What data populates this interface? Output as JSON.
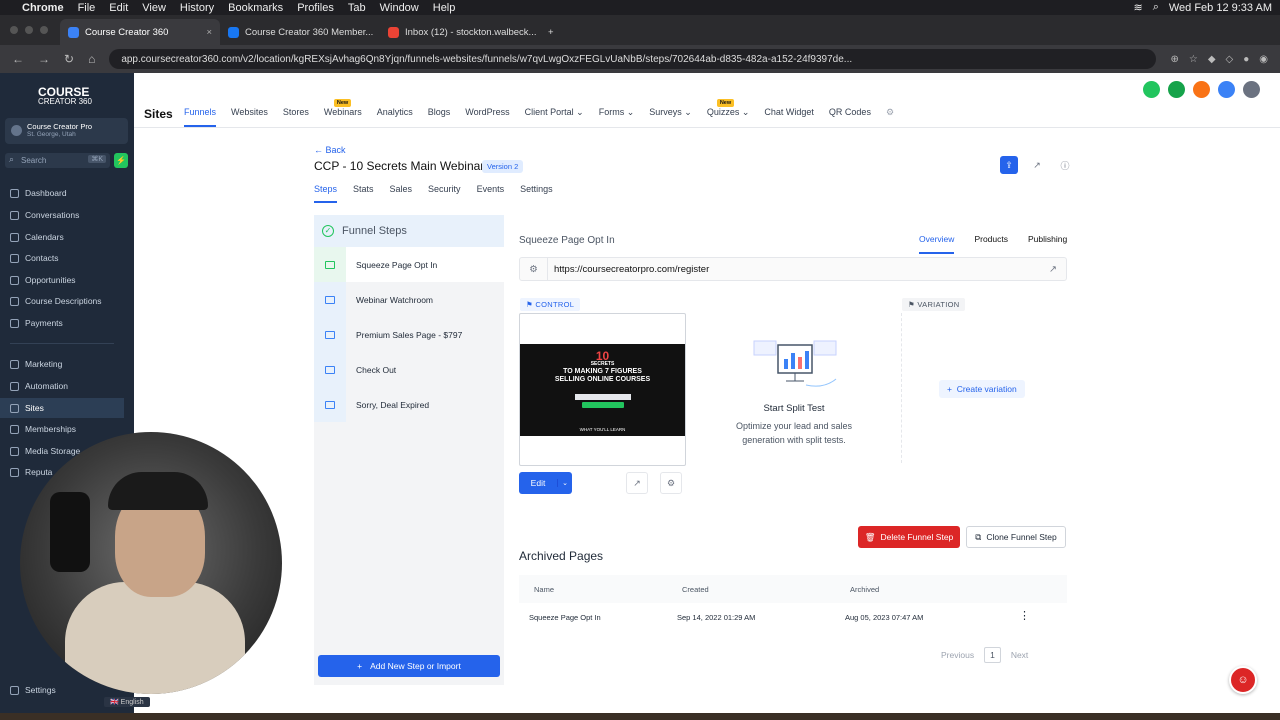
{
  "mac_menu": {
    "app": "Chrome",
    "items": [
      "File",
      "Edit",
      "View",
      "History",
      "Bookmarks",
      "Profiles",
      "Tab",
      "Window",
      "Help"
    ],
    "datetime": "Wed Feb 12  9:33 AM"
  },
  "browser": {
    "tabs": [
      {
        "title": "Course Creator 360",
        "color": "#3b82f6"
      },
      {
        "title": "Course Creator 360 Member...",
        "color": "#1877f2"
      },
      {
        "title": "Inbox (12) - stockton.walbeck...",
        "color": "#ea4335"
      }
    ],
    "url": "app.coursecreator360.com/v2/location/kgREXsjAvhag6Qn8Yjqn/funnels-websites/funnels/w7qvLwgOxzFEGLvUaNbB/steps/702644ab-d835-482a-a152-24f9397de..."
  },
  "sidebar": {
    "logo": "COURSE",
    "logo_sub": "CREATOR 360",
    "account_name": "Course Creator Pro",
    "account_location": "St. George, Utah",
    "search_placeholder": "Search",
    "search_shortcut": "⌘K",
    "items_top": [
      {
        "label": "Dashboard",
        "icon": "dashboard-icon"
      },
      {
        "label": "Conversations",
        "icon": "chat-icon"
      },
      {
        "label": "Calendars",
        "icon": "calendar-icon"
      },
      {
        "label": "Contacts",
        "icon": "contacts-icon"
      },
      {
        "label": "Opportunities",
        "icon": "opportunities-icon"
      },
      {
        "label": "Course Descriptions",
        "icon": "course-icon"
      },
      {
        "label": "Payments",
        "icon": "payments-icon"
      }
    ],
    "items_bottom": [
      {
        "label": "Marketing",
        "icon": "marketing-icon"
      },
      {
        "label": "Automation",
        "icon": "automation-icon"
      },
      {
        "label": "Sites",
        "icon": "sites-icon"
      },
      {
        "label": "Memberships",
        "icon": "memberships-icon"
      },
      {
        "label": "Media Storage",
        "icon": "media-icon"
      },
      {
        "label": "Reputa",
        "icon": "reputation-icon"
      }
    ],
    "settings": "Settings",
    "language": "English"
  },
  "topnav": {
    "section": "Sites",
    "links": [
      {
        "label": "Funnels",
        "active": true
      },
      {
        "label": "Websites"
      },
      {
        "label": "Stores"
      },
      {
        "label": "Webinars",
        "badge": "New"
      },
      {
        "label": "Analytics"
      },
      {
        "label": "Blogs"
      },
      {
        "label": "WordPress"
      },
      {
        "label": "Client Portal ⌄"
      },
      {
        "label": "Forms ⌄"
      },
      {
        "label": "Surveys ⌄"
      },
      {
        "label": "Quizzes ⌄",
        "badge": "New"
      },
      {
        "label": "Chat Widget"
      },
      {
        "label": "QR Codes"
      }
    ]
  },
  "funnel": {
    "back": "← Back",
    "title": "CCP - 10 Secrets Main Webinar",
    "version": "Version 2",
    "tabs": [
      "Steps",
      "Stats",
      "Sales",
      "Security",
      "Events",
      "Settings"
    ],
    "steps_header": "Funnel Steps",
    "steps": [
      "Squeeze Page Opt In",
      "Webinar Watchroom",
      "Premium Sales Page - $797",
      "Check Out",
      "Sorry, Deal Expired"
    ],
    "add_step": "Add New Step or Import"
  },
  "panel": {
    "step_title": "Squeeze Page Opt In",
    "tabs": [
      "Overview",
      "Products",
      "Publishing"
    ],
    "url": "https://coursecreatorpro.com/register",
    "control_label": "CONTROL",
    "variation_label": "VARIATION",
    "thumb": {
      "big": "10",
      "line1": "SECRETS",
      "line2": "TO MAKING 7 FIGURES",
      "line3": "SELLING ONLINE COURSES",
      "footer": "WHAT YOU'LL LEARN"
    },
    "edit": "Edit",
    "split_title": "Start Split Test",
    "split_desc": "Optimize your lead and sales generation with split tests.",
    "create_variation": "Create variation",
    "delete": "Delete Funnel Step",
    "clone": "Clone Funnel Step",
    "archived_title": "Archived Pages",
    "table_headers": [
      "Name",
      "Created",
      "Archived"
    ],
    "table_rows": [
      {
        "name": "Squeeze Page Opt In",
        "created": "Sep 14, 2022 01:29 AM",
        "archived": "Aug 05, 2023 07:47 AM"
      }
    ],
    "pager": {
      "prev": "Previous",
      "page": "1",
      "next": "Next"
    }
  }
}
